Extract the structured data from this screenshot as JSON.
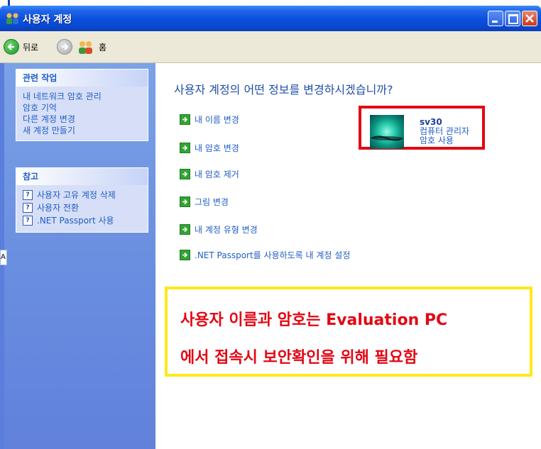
{
  "window": {
    "title": "사용자 계정"
  },
  "toolbar": {
    "back_label": "뒤로",
    "home_label": "홈"
  },
  "left_panel": {
    "related_tasks": {
      "header": "관련 작업",
      "items": [
        "내 네트워크 암호 관리",
        "암호 기억",
        "다른 계정 변경",
        "새 계정 만들기"
      ]
    },
    "see_also": {
      "header": "참고",
      "items": [
        "사용자 고유 계정 삭제",
        "사용자 전환",
        ".NET Passport 사용"
      ]
    }
  },
  "main": {
    "question": "사용자 계정의 어떤 정보를 변경하시겠습니까?",
    "actions": [
      "내 이름 변경",
      "내 암호 변경",
      "내 암호 제거",
      "그림 변경",
      "내 계정 유형 변경",
      ".NET Passport를 사용하도록 내 계정 설정"
    ],
    "user": {
      "name": "sv30",
      "role": "컴퓨터 관리자",
      "status": "암호 사용"
    }
  },
  "callout": {
    "line1": "사용자 이름과 암호는 Evaluation PC",
    "line2": "에서 접속시 보안확인을 위해 필요함"
  },
  "colors": {
    "titlebar": "#0a4fdc",
    "link": "#215dc6",
    "highlight_red": "#e30613",
    "highlight_yellow": "#ffe81a"
  }
}
